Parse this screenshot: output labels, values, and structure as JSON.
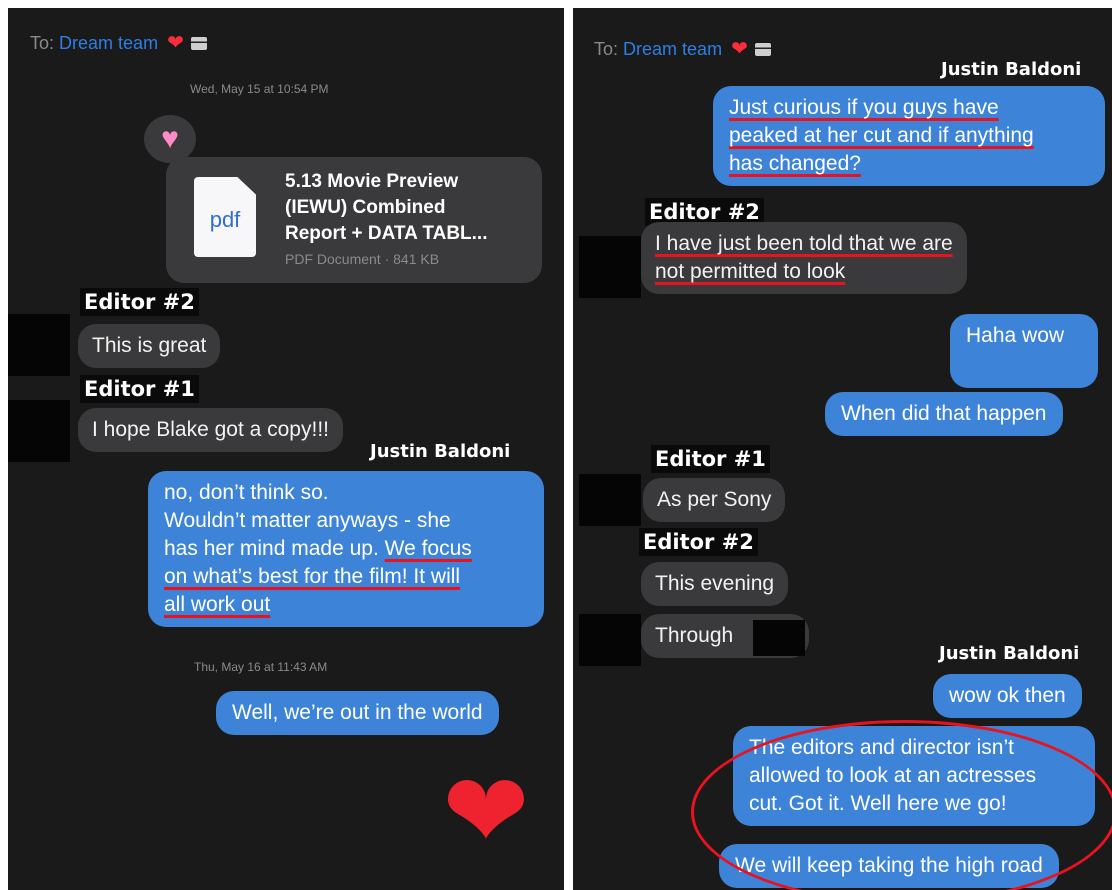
{
  "left": {
    "to_prefix": "To:",
    "to_name": "Dream team",
    "heart": "❤",
    "timestamp1": "Wed, May 15 at 10:54 PM",
    "tapback": "♥",
    "pdf": {
      "icon_label": "pdf",
      "title_lines": [
        "5.13 Movie Preview",
        "(IEWU) Combined",
        "Report + DATA TABL..."
      ],
      "subtitle": "PDF Document · 841 KB"
    },
    "editor2_label": "Editor #2",
    "editor2_message": "This is great",
    "editor1_label": "Editor #1",
    "editor1_message": "I hope Blake got a copy!!!",
    "justin_label": "Justin Baldoni",
    "justin_message": {
      "l1": "no, don’t think so.",
      "l2": "Wouldn’t matter anyways - she",
      "l3a": "has her mind made up. ",
      "l3b": "We focus",
      "l4": "on what’s best for the film! It will",
      "l5": "all work out"
    },
    "timestamp2": "Thu, May 16 at 11:43 AM",
    "sent_message": "Well, we’re out in the world",
    "big_heart": "❤"
  },
  "right": {
    "to_prefix": "To:",
    "to_name": "Dream team",
    "heart": "❤",
    "justin_label_1": "Justin Baldoni",
    "justin_message_1": [
      "Just curious if you guys have",
      "peaked at her cut and if anything",
      "has changed?"
    ],
    "editor2_label_1": "Editor #2",
    "editor2_message_1": [
      "I have just been told that we are",
      "not permitted to look"
    ],
    "sent_haha": "Haha wow",
    "sent_when": "When did that happen",
    "editor1_label": "Editor #1",
    "editor1_message": "As per Sony",
    "editor2_label_2": "Editor #2",
    "editor2_message_2": "This evening",
    "editor2_message_3": "Through",
    "justin_label_2": "Justin Baldoni",
    "sent_wow": "wow ok then",
    "sent_editors": [
      "The editors and director  isn’t",
      "allowed to look at an actresses",
      "cut. Got it. Well here we go!"
    ],
    "sent_high_road": "We will keep taking the high road"
  },
  "colors": {
    "panel_bg": "#1a1a1b",
    "incoming_bubble": "#3a3a3c",
    "outgoing_bubble": "#3d84d8",
    "annotation_red": "#e8131f",
    "link_blue": "#2d7fe3"
  }
}
